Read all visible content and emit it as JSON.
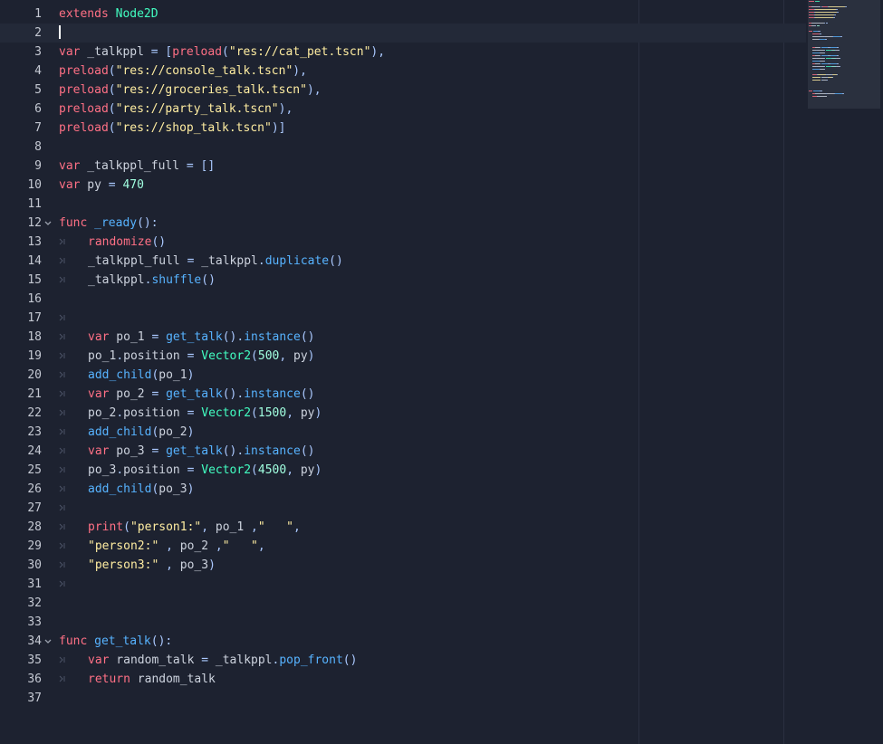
{
  "editor": {
    "current_line": 2,
    "lines": [
      {
        "num": "1",
        "indent": false,
        "fold": false,
        "tokens": [
          [
            "kw",
            "extends"
          ],
          [
            "id",
            " "
          ],
          [
            "type",
            "Node2D"
          ]
        ]
      },
      {
        "num": "2",
        "indent": false,
        "fold": false,
        "caret": true,
        "tokens": []
      },
      {
        "num": "3",
        "indent": false,
        "fold": false,
        "tokens": [
          [
            "kw",
            "var"
          ],
          [
            "id",
            " _talkppl "
          ],
          [
            "sym",
            "="
          ],
          [
            "id",
            " "
          ],
          [
            "sym",
            "["
          ],
          [
            "kw",
            "preload"
          ],
          [
            "sym",
            "("
          ],
          [
            "str",
            "\"res://cat_pet.tscn\""
          ],
          [
            "sym",
            "),"
          ]
        ]
      },
      {
        "num": "4",
        "indent": false,
        "fold": false,
        "tokens": [
          [
            "kw",
            "preload"
          ],
          [
            "sym",
            "("
          ],
          [
            "str",
            "\"res://console_talk.tscn\""
          ],
          [
            "sym",
            "),"
          ]
        ]
      },
      {
        "num": "5",
        "indent": false,
        "fold": false,
        "tokens": [
          [
            "kw",
            "preload"
          ],
          [
            "sym",
            "("
          ],
          [
            "str",
            "\"res://groceries_talk.tscn\""
          ],
          [
            "sym",
            "),"
          ]
        ]
      },
      {
        "num": "6",
        "indent": false,
        "fold": false,
        "tokens": [
          [
            "kw",
            "preload"
          ],
          [
            "sym",
            "("
          ],
          [
            "str",
            "\"res://party_talk.tscn\""
          ],
          [
            "sym",
            "),"
          ]
        ]
      },
      {
        "num": "7",
        "indent": false,
        "fold": false,
        "tokens": [
          [
            "kw",
            "preload"
          ],
          [
            "sym",
            "("
          ],
          [
            "str",
            "\"res://shop_talk.tscn\""
          ],
          [
            "sym",
            ")]"
          ]
        ]
      },
      {
        "num": "8",
        "indent": false,
        "fold": false,
        "tokens": []
      },
      {
        "num": "9",
        "indent": false,
        "fold": false,
        "tokens": [
          [
            "kw",
            "var"
          ],
          [
            "id",
            " _talkppl_full "
          ],
          [
            "sym",
            "="
          ],
          [
            "id",
            " "
          ],
          [
            "sym",
            "[]"
          ]
        ]
      },
      {
        "num": "10",
        "indent": false,
        "fold": false,
        "tokens": [
          [
            "kw",
            "var"
          ],
          [
            "id",
            " py "
          ],
          [
            "sym",
            "="
          ],
          [
            "id",
            " "
          ],
          [
            "num",
            "470"
          ]
        ]
      },
      {
        "num": "11",
        "indent": false,
        "fold": false,
        "tokens": []
      },
      {
        "num": "12",
        "indent": false,
        "fold": true,
        "tokens": [
          [
            "kw",
            "func"
          ],
          [
            "id",
            " "
          ],
          [
            "fn",
            "_ready"
          ],
          [
            "sym",
            "():"
          ]
        ]
      },
      {
        "num": "13",
        "indent": true,
        "fold": false,
        "tokens": [
          [
            "kw",
            "randomize"
          ],
          [
            "sym",
            "()"
          ]
        ]
      },
      {
        "num": "14",
        "indent": true,
        "fold": false,
        "tokens": [
          [
            "id",
            "_talkppl_full "
          ],
          [
            "sym",
            "="
          ],
          [
            "id",
            " _talkppl"
          ],
          [
            "sym",
            "."
          ],
          [
            "fn",
            "duplicate"
          ],
          [
            "sym",
            "()"
          ]
        ]
      },
      {
        "num": "15",
        "indent": true,
        "fold": false,
        "tokens": [
          [
            "id",
            "_talkppl"
          ],
          [
            "sym",
            "."
          ],
          [
            "fn",
            "shuffle"
          ],
          [
            "sym",
            "()"
          ]
        ]
      },
      {
        "num": "16",
        "indent": false,
        "fold": false,
        "tokens": []
      },
      {
        "num": "17",
        "indent": true,
        "fold": false,
        "tokens": []
      },
      {
        "num": "18",
        "indent": true,
        "fold": false,
        "tokens": [
          [
            "kw",
            "var"
          ],
          [
            "id",
            " po_1 "
          ],
          [
            "sym",
            "="
          ],
          [
            "id",
            " "
          ],
          [
            "fn",
            "get_talk"
          ],
          [
            "sym",
            "()."
          ],
          [
            "fn",
            "instance"
          ],
          [
            "sym",
            "()"
          ]
        ]
      },
      {
        "num": "19",
        "indent": true,
        "fold": false,
        "tokens": [
          [
            "id",
            "po_1"
          ],
          [
            "sym",
            "."
          ],
          [
            "id",
            "position "
          ],
          [
            "sym",
            "="
          ],
          [
            "id",
            " "
          ],
          [
            "type",
            "Vector2"
          ],
          [
            "sym",
            "("
          ],
          [
            "num",
            "500"
          ],
          [
            "sym",
            ","
          ],
          [
            "id",
            " py"
          ],
          [
            "sym",
            ")"
          ]
        ]
      },
      {
        "num": "20",
        "indent": true,
        "fold": false,
        "tokens": [
          [
            "fn",
            "add_child"
          ],
          [
            "sym",
            "("
          ],
          [
            "id",
            "po_1"
          ],
          [
            "sym",
            ")"
          ]
        ]
      },
      {
        "num": "21",
        "indent": true,
        "fold": false,
        "tokens": [
          [
            "kw",
            "var"
          ],
          [
            "id",
            " po_2 "
          ],
          [
            "sym",
            "="
          ],
          [
            "id",
            " "
          ],
          [
            "fn",
            "get_talk"
          ],
          [
            "sym",
            "()."
          ],
          [
            "fn",
            "instance"
          ],
          [
            "sym",
            "()"
          ]
        ]
      },
      {
        "num": "22",
        "indent": true,
        "fold": false,
        "tokens": [
          [
            "id",
            "po_2"
          ],
          [
            "sym",
            "."
          ],
          [
            "id",
            "position "
          ],
          [
            "sym",
            "="
          ],
          [
            "id",
            " "
          ],
          [
            "type",
            "Vector2"
          ],
          [
            "sym",
            "("
          ],
          [
            "num",
            "1500"
          ],
          [
            "sym",
            ","
          ],
          [
            "id",
            " py"
          ],
          [
            "sym",
            ")"
          ]
        ]
      },
      {
        "num": "23",
        "indent": true,
        "fold": false,
        "tokens": [
          [
            "fn",
            "add_child"
          ],
          [
            "sym",
            "("
          ],
          [
            "id",
            "po_2"
          ],
          [
            "sym",
            ")"
          ]
        ]
      },
      {
        "num": "24",
        "indent": true,
        "fold": false,
        "tokens": [
          [
            "kw",
            "var"
          ],
          [
            "id",
            " po_3 "
          ],
          [
            "sym",
            "="
          ],
          [
            "id",
            " "
          ],
          [
            "fn",
            "get_talk"
          ],
          [
            "sym",
            "()."
          ],
          [
            "fn",
            "instance"
          ],
          [
            "sym",
            "()"
          ]
        ]
      },
      {
        "num": "25",
        "indent": true,
        "fold": false,
        "tokens": [
          [
            "id",
            "po_3"
          ],
          [
            "sym",
            "."
          ],
          [
            "id",
            "position "
          ],
          [
            "sym",
            "="
          ],
          [
            "id",
            " "
          ],
          [
            "type",
            "Vector2"
          ],
          [
            "sym",
            "("
          ],
          [
            "num",
            "4500"
          ],
          [
            "sym",
            ","
          ],
          [
            "id",
            " py"
          ],
          [
            "sym",
            ")"
          ]
        ]
      },
      {
        "num": "26",
        "indent": true,
        "fold": false,
        "tokens": [
          [
            "fn",
            "add_child"
          ],
          [
            "sym",
            "("
          ],
          [
            "id",
            "po_3"
          ],
          [
            "sym",
            ")"
          ]
        ]
      },
      {
        "num": "27",
        "indent": true,
        "fold": false,
        "tokens": []
      },
      {
        "num": "28",
        "indent": true,
        "fold": false,
        "tokens": [
          [
            "kw",
            "print"
          ],
          [
            "sym",
            "("
          ],
          [
            "str",
            "\"person1:\""
          ],
          [
            "sym",
            ","
          ],
          [
            "id",
            " po_1 "
          ],
          [
            "sym",
            ","
          ],
          [
            "str",
            "\"   \""
          ],
          [
            "sym",
            ","
          ]
        ]
      },
      {
        "num": "29",
        "indent": true,
        "fold": false,
        "tokens": [
          [
            "str",
            "\"person2:\""
          ],
          [
            "id",
            " "
          ],
          [
            "sym",
            ","
          ],
          [
            "id",
            " po_2 "
          ],
          [
            "sym",
            ","
          ],
          [
            "str",
            "\"   \""
          ],
          [
            "sym",
            ","
          ]
        ]
      },
      {
        "num": "30",
        "indent": true,
        "fold": false,
        "tokens": [
          [
            "str",
            "\"person3:\""
          ],
          [
            "id",
            " "
          ],
          [
            "sym",
            ","
          ],
          [
            "id",
            " po_3"
          ],
          [
            "sym",
            ")"
          ]
        ]
      },
      {
        "num": "31",
        "indent": true,
        "fold": false,
        "tokens": []
      },
      {
        "num": "32",
        "indent": false,
        "fold": false,
        "tokens": []
      },
      {
        "num": "33",
        "indent": false,
        "fold": false,
        "tokens": []
      },
      {
        "num": "34",
        "indent": false,
        "fold": true,
        "tokens": [
          [
            "kw",
            "func"
          ],
          [
            "id",
            " "
          ],
          [
            "fn",
            "get_talk"
          ],
          [
            "sym",
            "():"
          ]
        ]
      },
      {
        "num": "35",
        "indent": true,
        "fold": false,
        "tokens": [
          [
            "kw",
            "var"
          ],
          [
            "id",
            " random_talk "
          ],
          [
            "sym",
            "="
          ],
          [
            "id",
            " _talkppl"
          ],
          [
            "sym",
            "."
          ],
          [
            "fn",
            "pop_front"
          ],
          [
            "sym",
            "()"
          ]
        ]
      },
      {
        "num": "36",
        "indent": true,
        "fold": false,
        "tokens": [
          [
            "kw",
            "return"
          ],
          [
            "id",
            " random_talk"
          ]
        ]
      },
      {
        "num": "37",
        "indent": false,
        "fold": false,
        "tokens": []
      }
    ]
  },
  "icons": {
    "fold": "chevron-down-icon",
    "tab": "tab-indent-icon"
  },
  "colors": {
    "background": "#1d2230",
    "current_line": "#232938",
    "keyword": "#ff7085",
    "type": "#42ffc2",
    "function": "#57b3ff",
    "string": "#ffeda1",
    "number": "#a1ffe0",
    "symbol": "#abc9ff",
    "identifier": "#cdd3de"
  }
}
